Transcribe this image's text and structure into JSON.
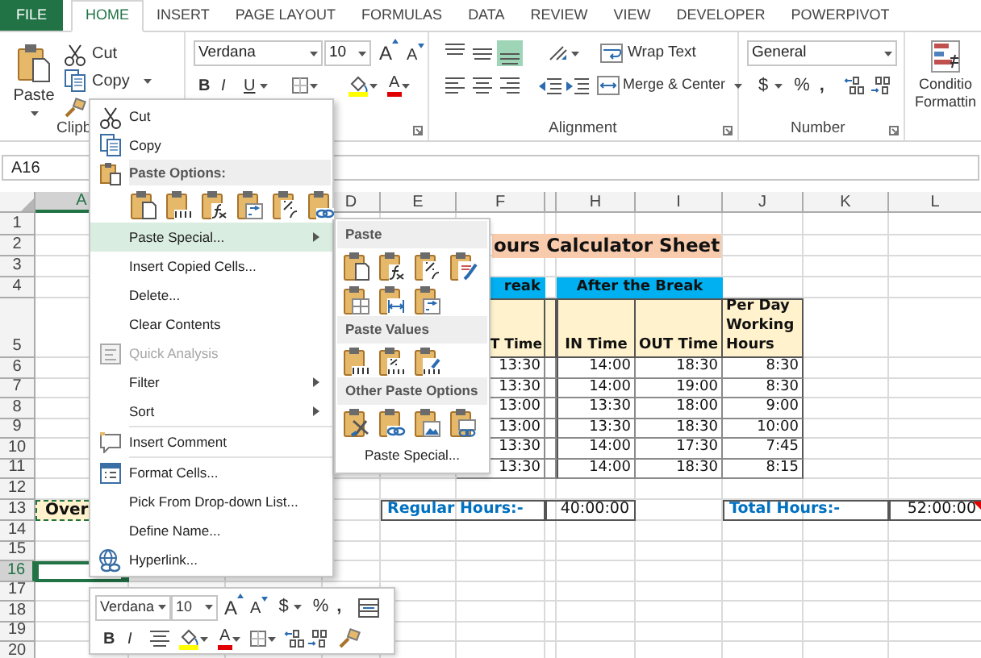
{
  "ribbon_tabs": [
    {
      "label": "FILE",
      "kind": "file",
      "selected": false
    },
    {
      "label": "HOME",
      "kind": "tab",
      "selected": true
    },
    {
      "label": "INSERT",
      "kind": "tab",
      "selected": false
    },
    {
      "label": "PAGE LAYOUT",
      "kind": "tab",
      "selected": false
    },
    {
      "label": "FORMULAS",
      "kind": "tab",
      "selected": false
    },
    {
      "label": "DATA",
      "kind": "tab",
      "selected": false
    },
    {
      "label": "REVIEW",
      "kind": "tab",
      "selected": false
    },
    {
      "label": "VIEW",
      "kind": "tab",
      "selected": false
    },
    {
      "label": "DEVELOPER",
      "kind": "tab",
      "selected": false
    },
    {
      "label": "POWERPIVOT",
      "kind": "tab",
      "selected": false
    }
  ],
  "clipboard": {
    "paste": "Paste",
    "cut": "Cut",
    "copy": "Copy",
    "group_label": "Clipb"
  },
  "font": {
    "name": "Verdana",
    "size": "10",
    "grow": "A",
    "shrink": "A",
    "bold": "B",
    "italic": "I",
    "underline": "U",
    "font_color": "A"
  },
  "alignment": {
    "vertical": [
      {
        "selected": false
      },
      {
        "selected": false
      },
      {
        "selected": true
      }
    ],
    "wrap_text": "Wrap Text",
    "merge": "Merge & Center",
    "group_label": "Alignment"
  },
  "number": {
    "format": "General",
    "currency": "$",
    "percent": "%",
    "comma": ",",
    "group_label": "Number"
  },
  "styles": {
    "button_lines": [
      "Conditio",
      "Formattin"
    ]
  },
  "name_box": "A16",
  "sheet": {
    "columns": [
      {
        "label": "A",
        "selected": true
      },
      {
        "label": "D",
        "selected": false
      },
      {
        "label": "E",
        "selected": false
      },
      {
        "label": "F",
        "selected": false
      },
      {
        "selected": false
      },
      {
        "label": "H",
        "selected": false
      },
      {
        "label": "I",
        "selected": false
      },
      {
        "label": "J",
        "selected": false
      },
      {
        "label": "K",
        "selected": false
      },
      {
        "label": "L",
        "selected": false
      }
    ],
    "rows": [
      {
        "label": "1",
        "selected": false
      },
      {
        "label": "2",
        "selected": false
      },
      {
        "label": "3",
        "selected": false
      },
      {
        "label": "4",
        "selected": false
      },
      {
        "label": "5",
        "selected": false
      },
      {
        "label": "6",
        "selected": false
      },
      {
        "label": "7",
        "selected": false
      },
      {
        "label": "8",
        "selected": false
      },
      {
        "label": "9",
        "selected": false
      },
      {
        "label": "10",
        "selected": false
      },
      {
        "label": "11",
        "selected": false
      },
      {
        "label": "12",
        "selected": false
      },
      {
        "label": "13",
        "selected": false
      },
      {
        "label": "14",
        "selected": false
      },
      {
        "label": "15",
        "selected": false
      },
      {
        "label": "16",
        "selected": true
      },
      {
        "label": "17",
        "selected": false
      },
      {
        "label": "18",
        "selected": false
      },
      {
        "label": "19",
        "selected": false
      },
      {
        "label": "20",
        "selected": false
      }
    ],
    "title": "ours Calculator Sheet",
    "section_headers": [
      "reak",
      "After the Break"
    ],
    "table": {
      "columns": [
        "T Time",
        "IN Time",
        "OUT Time",
        "Per Day Working Hours"
      ],
      "rows": [
        [
          "13:30",
          "14:00",
          "18:30",
          "8:30"
        ],
        [
          "13:30",
          "14:00",
          "19:00",
          "8:30"
        ],
        [
          "13:00",
          "13:30",
          "18:00",
          "9:00"
        ],
        [
          "13:00",
          "13:30",
          "18:30",
          "10:00"
        ],
        [
          "13:30",
          "14:00",
          "17:30",
          "7:45"
        ],
        [
          "13:30",
          "14:00",
          "18:30",
          "8:15"
        ]
      ]
    },
    "copied_cell": {
      "text": "Over",
      "copied": true
    },
    "summary": [
      {
        "label": "Regular Hours:-",
        "value": "40:00:00",
        "comment": false
      },
      {
        "label": "Total Hours:-",
        "value": "52:00:00",
        "comment": true
      }
    ]
  },
  "context_menu": {
    "items": [
      {
        "kind": "item",
        "label": "Cut",
        "selected": false,
        "disabled": false,
        "submenu": false
      },
      {
        "kind": "item",
        "label": "Copy",
        "selected": false,
        "disabled": false,
        "submenu": false
      },
      {
        "kind": "header",
        "label": "Paste Options:"
      },
      {
        "kind": "icons"
      },
      {
        "kind": "item",
        "label": "Paste Special...",
        "selected": true,
        "disabled": false,
        "submenu": true
      },
      {
        "kind": "item",
        "label": "Insert Copied Cells...",
        "selected": false,
        "disabled": false,
        "submenu": false
      },
      {
        "kind": "item",
        "label": "Delete...",
        "selected": false,
        "disabled": false,
        "submenu": false
      },
      {
        "kind": "item",
        "label": "Clear Contents",
        "selected": false,
        "disabled": false,
        "submenu": false
      },
      {
        "kind": "item",
        "label": "Quick Analysis",
        "selected": false,
        "disabled": true,
        "submenu": false
      },
      {
        "kind": "item",
        "label": "Filter",
        "selected": false,
        "disabled": false,
        "submenu": true
      },
      {
        "kind": "item",
        "label": "Sort",
        "selected": false,
        "disabled": false,
        "submenu": true
      },
      {
        "kind": "separator"
      },
      {
        "kind": "item",
        "label": "Insert Comment",
        "selected": false,
        "disabled": false,
        "submenu": false
      },
      {
        "kind": "separator"
      },
      {
        "kind": "item",
        "label": "Format Cells...",
        "selected": false,
        "disabled": false,
        "submenu": false
      },
      {
        "kind": "item",
        "label": "Pick From Drop-down List...",
        "selected": false,
        "disabled": false,
        "submenu": false
      },
      {
        "kind": "item",
        "label": "Define Name...",
        "selected": false,
        "disabled": false,
        "submenu": false
      },
      {
        "kind": "item",
        "label": "Hyperlink...",
        "selected": false,
        "disabled": false,
        "submenu": false
      }
    ]
  },
  "paste_submenu": {
    "sections": [
      "Paste",
      "Paste Values",
      "Other Paste Options"
    ],
    "footer": "Paste Special..."
  },
  "mini_toolbar": {
    "font": "Verdana",
    "size": "10",
    "grow": "A",
    "shrink": "A",
    "currency": "$",
    "percent": "%",
    "comma": ",",
    "bold": "B",
    "italic": "I",
    "font_color": "A"
  }
}
